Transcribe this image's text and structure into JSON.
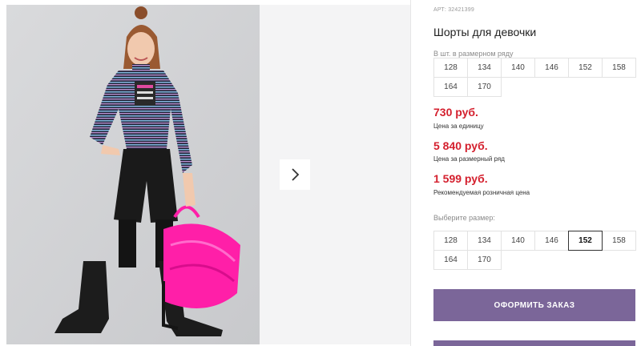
{
  "product": {
    "sku_label": "АРТ: 32421399",
    "title": "Шорты для девочки"
  },
  "size_row": {
    "label": "В шт. в размерном ряду",
    "sizes": [
      "128",
      "134",
      "140",
      "146",
      "152",
      "158",
      "164",
      "170"
    ]
  },
  "prices": {
    "unit_price": "730 руб.",
    "unit_note": "Цена за единицу",
    "row_price": "5 840 руб.",
    "row_note": "Цена за размерный ряд",
    "retail_price": "1 599 руб.",
    "retail_note": "Рекомендуемая розничная цена"
  },
  "size_select": {
    "label": "Выберите размер:",
    "sizes": [
      "128",
      "134",
      "140",
      "146",
      "152",
      "158",
      "164",
      "170"
    ],
    "selected": "152"
  },
  "actions": {
    "order_label": "ОФОРМИТЬ ЗАКАЗ"
  },
  "colors": {
    "accent": "#7b6699",
    "price": "#d4202e",
    "bag": "#ff1fa8"
  },
  "icons": {
    "next": "chevron-right-icon"
  }
}
